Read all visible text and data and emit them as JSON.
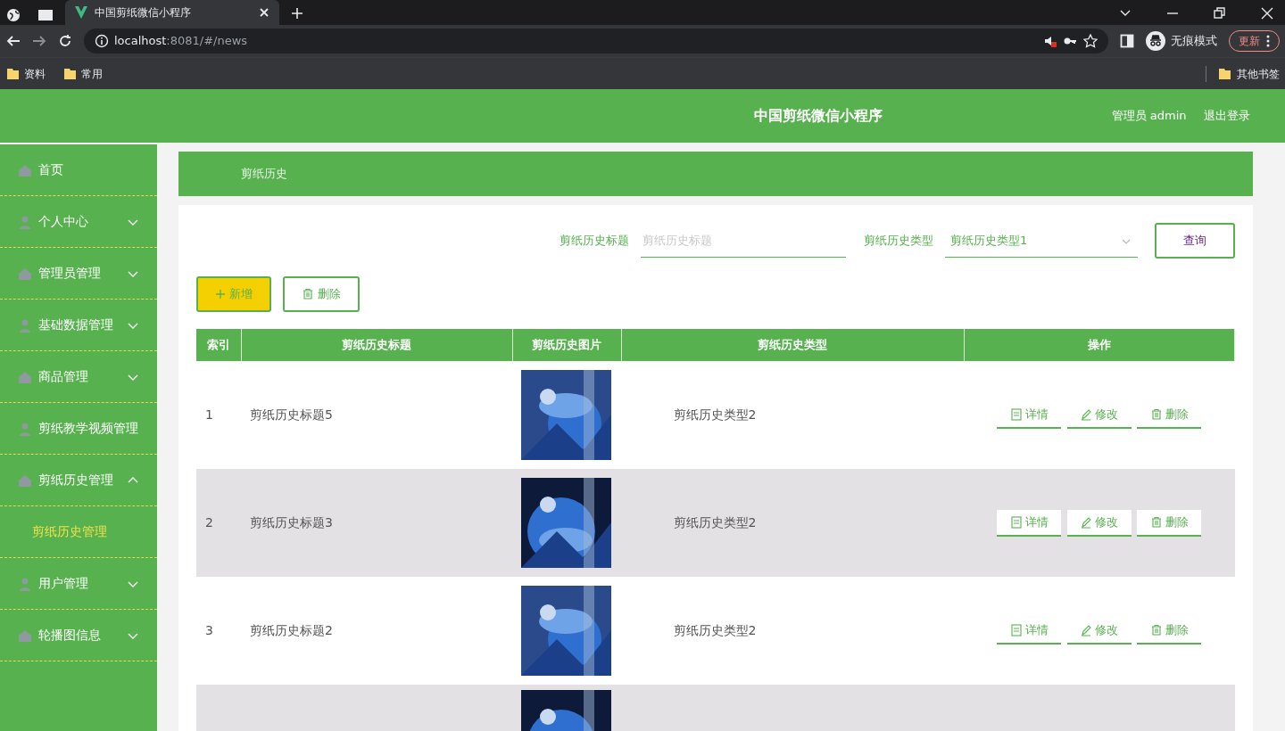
{
  "browser": {
    "tabs": [
      {
        "title": "中国剪纸微信小程序",
        "selected": true
      }
    ],
    "url_host": "localhost",
    "url_rest": ":8081/#/news",
    "incognito": "无痕模式",
    "update_button": "更新",
    "bookmarks": [
      "资料",
      "常用"
    ],
    "other_bookmarks": "其他书签"
  },
  "header": {
    "title": "中国剪纸微信小程序",
    "user": "管理员 admin",
    "logout": "退出登录"
  },
  "sidebar": {
    "items": [
      {
        "label": "首页"
      },
      {
        "label": "个人中心",
        "expanded": false
      },
      {
        "label": "管理员管理",
        "expanded": false
      },
      {
        "label": "基础数据管理",
        "expanded": false
      },
      {
        "label": "商品管理",
        "expanded": false
      },
      {
        "label": "剪纸教学视频管理"
      },
      {
        "label": "剪纸历史管理",
        "expanded": true,
        "children": [
          {
            "label": "剪纸历史管理",
            "selected": true
          }
        ]
      },
      {
        "label": "用户管理",
        "expanded": false
      },
      {
        "label": "轮播图信息",
        "expanded": false
      }
    ]
  },
  "breadcrumb": "剪纸历史",
  "search": {
    "title_label": "剪纸历史标题",
    "title_placeholder": "剪纸历史标题",
    "type_label": "剪纸历史类型",
    "type_value": "剪纸历史类型1",
    "query_button": "查询"
  },
  "toolbar": {
    "add_button": "新增",
    "delete_button": "删除"
  },
  "table": {
    "columns": [
      "索引",
      "剪纸历史标题",
      "剪纸历史图片",
      "剪纸历史类型",
      "操作"
    ],
    "rows": [
      {
        "index": "1",
        "title": "剪纸历史标题5",
        "image": {
          "kind": "picture"
        },
        "type": "剪纸历史类型2",
        "actions": [
          "详情",
          "修改",
          "删除"
        ]
      },
      {
        "index": "2",
        "title": "剪纸历史标题3",
        "image": {
          "kind": "picture"
        },
        "type": "剪纸历史类型2",
        "actions": [
          "详情",
          "修改",
          "删除"
        ]
      },
      {
        "index": "3",
        "title": "剪纸历史标题2",
        "image": {
          "kind": "picture"
        },
        "type": "剪纸历史类型2",
        "actions": [
          "详情",
          "修改",
          "删除"
        ]
      },
      {
        "image": {
          "kind": "picture"
        }
      }
    ]
  }
}
